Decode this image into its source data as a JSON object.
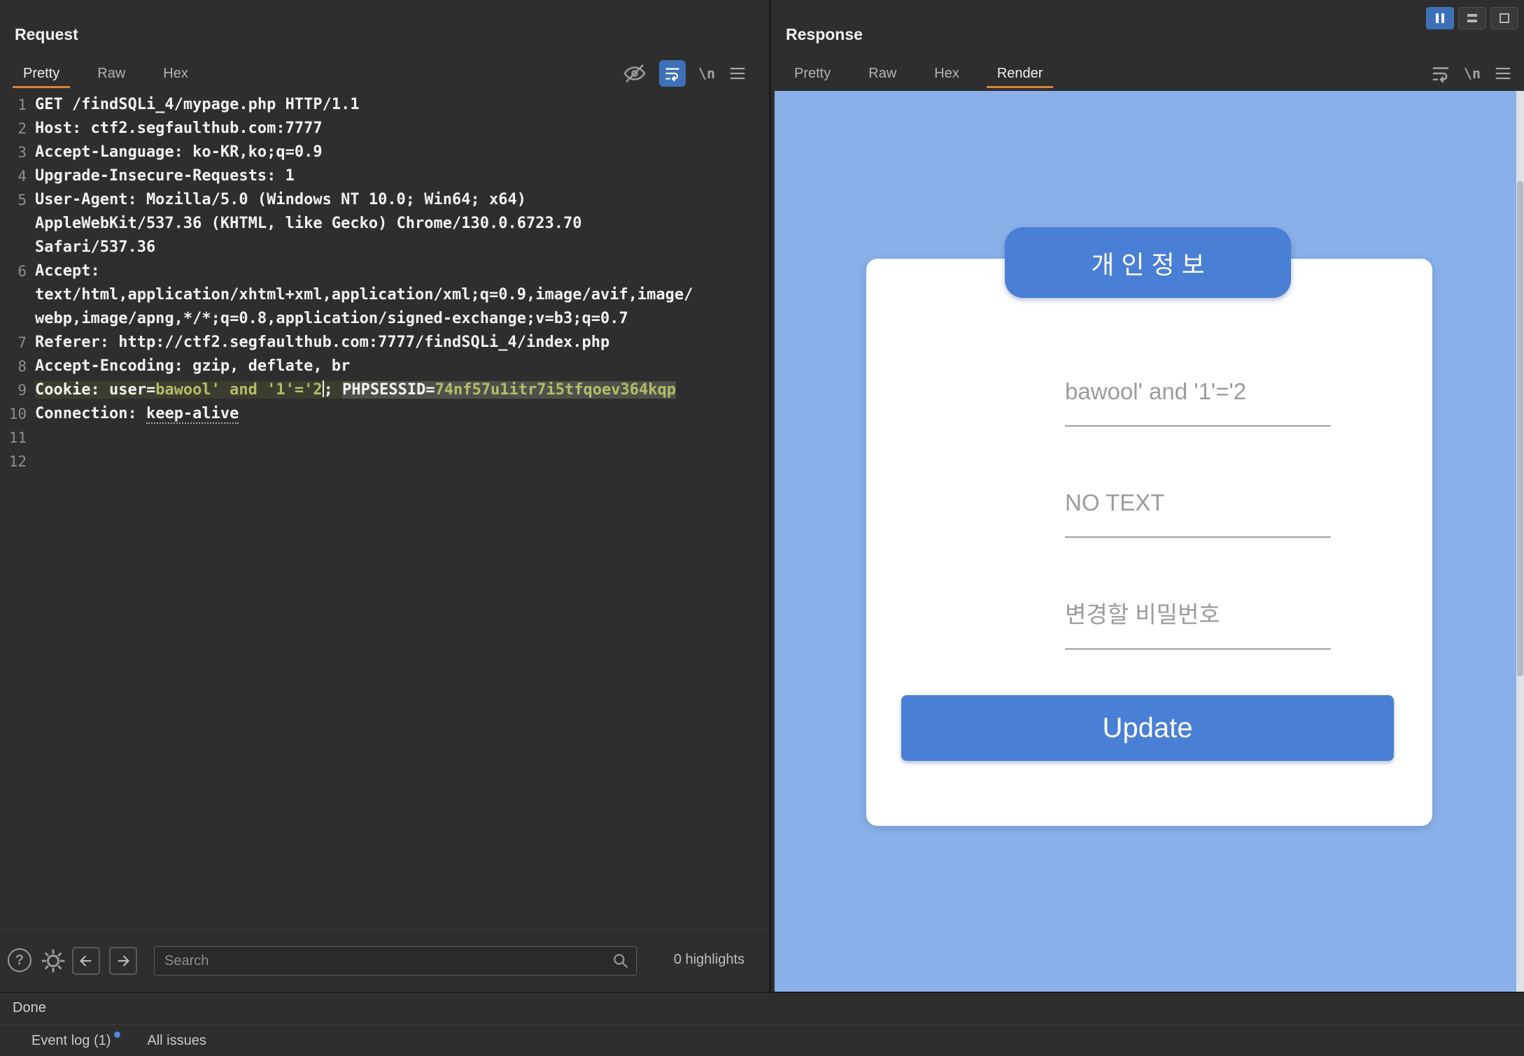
{
  "colors": {
    "tab_underline_orange": "#d9853e",
    "toolbar_active_blue": "#3e70b8",
    "editor_value_olive": "#b5bd68",
    "render_page_blue": "#89b0e8",
    "render_accent_blue": "#4a7fd6"
  },
  "window": {
    "layout_buttons": [
      {
        "name": "layout-columns",
        "active": true
      },
      {
        "name": "layout-rows",
        "active": false
      },
      {
        "name": "layout-single",
        "active": false
      }
    ]
  },
  "request": {
    "title": "Request",
    "tabs": [
      {
        "label": "Pretty",
        "active": true
      },
      {
        "label": "Raw",
        "active": false
      },
      {
        "label": "Hex",
        "active": false
      }
    ],
    "newline_icon_label": "\\n",
    "lines": [
      {
        "num": 1,
        "segs": [
          {
            "t": "GET /findSQLi_4/mypage.php HTTP/1.1"
          }
        ]
      },
      {
        "num": 2,
        "segs": [
          {
            "t": "Host: ctf2.segfaulthub.com:7777"
          }
        ]
      },
      {
        "num": 3,
        "segs": [
          {
            "t": "Accept-Language: ko-KR,ko;q=0.9"
          }
        ]
      },
      {
        "num": 4,
        "segs": [
          {
            "t": "Upgrade-Insecure-Requests: 1"
          }
        ]
      },
      {
        "num": 5,
        "segs": [
          {
            "t": "User-Agent: Mozilla/5.0 (Windows NT 10.0; Win64; x64) AppleWebKit/537.36 (KHTML, like Gecko) Chrome/130.0.6723.70 Safari/537.36"
          }
        ]
      },
      {
        "num": 6,
        "segs": [
          {
            "t": "Accept: text/html,application/xhtml+xml,application/xml;q=0.9,image/avif,image/webp,image/apng,*/*;q=0.8,application/signed-exchange;v=b3;q=0.7"
          }
        ]
      },
      {
        "num": 7,
        "segs": [
          {
            "t": "Referer: http://ctf2.segfaulthub.com:7777/findSQLi_4/index.php"
          }
        ]
      },
      {
        "num": 8,
        "segs": [
          {
            "t": "Accept-Encoding: gzip, deflate, br"
          }
        ]
      },
      {
        "num": 9,
        "highlight": true,
        "segs": [
          {
            "t": "Cookie: user="
          },
          {
            "t": "bawool' and '1'='2",
            "c": "value"
          },
          {
            "caret": true
          },
          {
            "t": "; "
          },
          {
            "t": "PHPSESSID=",
            "hl": true
          },
          {
            "t": "74nf57u1itr7i5tfqoev364kqp",
            "c": "value",
            "hl": true
          }
        ]
      },
      {
        "num": 10,
        "segs": [
          {
            "t": "Connection: "
          },
          {
            "t": "keep-alive",
            "u": true
          }
        ]
      },
      {
        "num": 11,
        "segs": []
      },
      {
        "num": 12,
        "segs": []
      }
    ],
    "footer": {
      "search_placeholder": "Search",
      "highlights_label": "0 highlights"
    }
  },
  "response": {
    "title": "Response",
    "tabs": [
      {
        "label": "Pretty",
        "active": false
      },
      {
        "label": "Raw",
        "active": false
      },
      {
        "label": "Hex",
        "active": false
      },
      {
        "label": "Render",
        "active": true
      }
    ],
    "newline_icon_label": "\\n",
    "render": {
      "heading": "개인정보",
      "fields": [
        {
          "text": "bawool' and '1'='2"
        },
        {
          "text": "NO TEXT"
        },
        {
          "text": "변경할 비밀번호"
        }
      ],
      "button_label": "Update"
    }
  },
  "status": {
    "done": "Done",
    "event_log": "Event log (1)",
    "all_issues": "All issues"
  }
}
